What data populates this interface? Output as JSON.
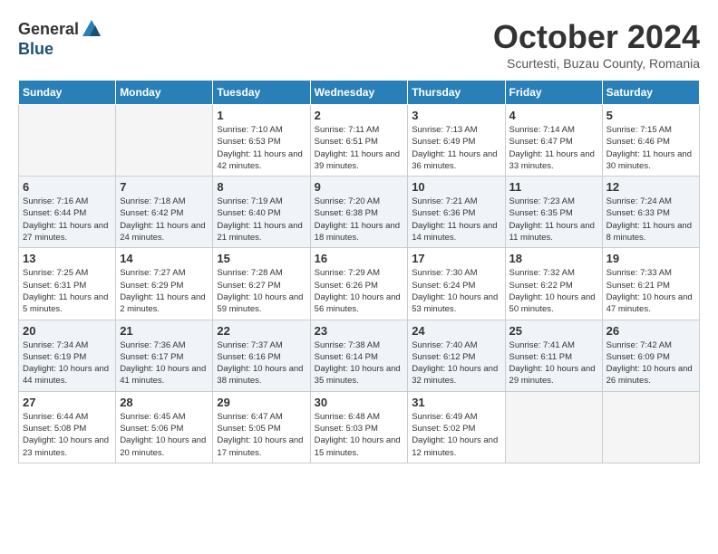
{
  "logo": {
    "general": "General",
    "blue": "Blue"
  },
  "title": "October 2024",
  "location": "Scurtesti, Buzau County, Romania",
  "days_of_week": [
    "Sunday",
    "Monday",
    "Tuesday",
    "Wednesday",
    "Thursday",
    "Friday",
    "Saturday"
  ],
  "weeks": [
    [
      {
        "day": "",
        "sunrise": "",
        "sunset": "",
        "daylight": "",
        "empty": true
      },
      {
        "day": "",
        "sunrise": "",
        "sunset": "",
        "daylight": "",
        "empty": true
      },
      {
        "day": "1",
        "sunrise": "Sunrise: 7:10 AM",
        "sunset": "Sunset: 6:53 PM",
        "daylight": "Daylight: 11 hours and 42 minutes.",
        "empty": false
      },
      {
        "day": "2",
        "sunrise": "Sunrise: 7:11 AM",
        "sunset": "Sunset: 6:51 PM",
        "daylight": "Daylight: 11 hours and 39 minutes.",
        "empty": false
      },
      {
        "day": "3",
        "sunrise": "Sunrise: 7:13 AM",
        "sunset": "Sunset: 6:49 PM",
        "daylight": "Daylight: 11 hours and 36 minutes.",
        "empty": false
      },
      {
        "day": "4",
        "sunrise": "Sunrise: 7:14 AM",
        "sunset": "Sunset: 6:47 PM",
        "daylight": "Daylight: 11 hours and 33 minutes.",
        "empty": false
      },
      {
        "day": "5",
        "sunrise": "Sunrise: 7:15 AM",
        "sunset": "Sunset: 6:46 PM",
        "daylight": "Daylight: 11 hours and 30 minutes.",
        "empty": false
      }
    ],
    [
      {
        "day": "6",
        "sunrise": "Sunrise: 7:16 AM",
        "sunset": "Sunset: 6:44 PM",
        "daylight": "Daylight: 11 hours and 27 minutes.",
        "empty": false
      },
      {
        "day": "7",
        "sunrise": "Sunrise: 7:18 AM",
        "sunset": "Sunset: 6:42 PM",
        "daylight": "Daylight: 11 hours and 24 minutes.",
        "empty": false
      },
      {
        "day": "8",
        "sunrise": "Sunrise: 7:19 AM",
        "sunset": "Sunset: 6:40 PM",
        "daylight": "Daylight: 11 hours and 21 minutes.",
        "empty": false
      },
      {
        "day": "9",
        "sunrise": "Sunrise: 7:20 AM",
        "sunset": "Sunset: 6:38 PM",
        "daylight": "Daylight: 11 hours and 18 minutes.",
        "empty": false
      },
      {
        "day": "10",
        "sunrise": "Sunrise: 7:21 AM",
        "sunset": "Sunset: 6:36 PM",
        "daylight": "Daylight: 11 hours and 14 minutes.",
        "empty": false
      },
      {
        "day": "11",
        "sunrise": "Sunrise: 7:23 AM",
        "sunset": "Sunset: 6:35 PM",
        "daylight": "Daylight: 11 hours and 11 minutes.",
        "empty": false
      },
      {
        "day": "12",
        "sunrise": "Sunrise: 7:24 AM",
        "sunset": "Sunset: 6:33 PM",
        "daylight": "Daylight: 11 hours and 8 minutes.",
        "empty": false
      }
    ],
    [
      {
        "day": "13",
        "sunrise": "Sunrise: 7:25 AM",
        "sunset": "Sunset: 6:31 PM",
        "daylight": "Daylight: 11 hours and 5 minutes.",
        "empty": false
      },
      {
        "day": "14",
        "sunrise": "Sunrise: 7:27 AM",
        "sunset": "Sunset: 6:29 PM",
        "daylight": "Daylight: 11 hours and 2 minutes.",
        "empty": false
      },
      {
        "day": "15",
        "sunrise": "Sunrise: 7:28 AM",
        "sunset": "Sunset: 6:27 PM",
        "daylight": "Daylight: 10 hours and 59 minutes.",
        "empty": false
      },
      {
        "day": "16",
        "sunrise": "Sunrise: 7:29 AM",
        "sunset": "Sunset: 6:26 PM",
        "daylight": "Daylight: 10 hours and 56 minutes.",
        "empty": false
      },
      {
        "day": "17",
        "sunrise": "Sunrise: 7:30 AM",
        "sunset": "Sunset: 6:24 PM",
        "daylight": "Daylight: 10 hours and 53 minutes.",
        "empty": false
      },
      {
        "day": "18",
        "sunrise": "Sunrise: 7:32 AM",
        "sunset": "Sunset: 6:22 PM",
        "daylight": "Daylight: 10 hours and 50 minutes.",
        "empty": false
      },
      {
        "day": "19",
        "sunrise": "Sunrise: 7:33 AM",
        "sunset": "Sunset: 6:21 PM",
        "daylight": "Daylight: 10 hours and 47 minutes.",
        "empty": false
      }
    ],
    [
      {
        "day": "20",
        "sunrise": "Sunrise: 7:34 AM",
        "sunset": "Sunset: 6:19 PM",
        "daylight": "Daylight: 10 hours and 44 minutes.",
        "empty": false
      },
      {
        "day": "21",
        "sunrise": "Sunrise: 7:36 AM",
        "sunset": "Sunset: 6:17 PM",
        "daylight": "Daylight: 10 hours and 41 minutes.",
        "empty": false
      },
      {
        "day": "22",
        "sunrise": "Sunrise: 7:37 AM",
        "sunset": "Sunset: 6:16 PM",
        "daylight": "Daylight: 10 hours and 38 minutes.",
        "empty": false
      },
      {
        "day": "23",
        "sunrise": "Sunrise: 7:38 AM",
        "sunset": "Sunset: 6:14 PM",
        "daylight": "Daylight: 10 hours and 35 minutes.",
        "empty": false
      },
      {
        "day": "24",
        "sunrise": "Sunrise: 7:40 AM",
        "sunset": "Sunset: 6:12 PM",
        "daylight": "Daylight: 10 hours and 32 minutes.",
        "empty": false
      },
      {
        "day": "25",
        "sunrise": "Sunrise: 7:41 AM",
        "sunset": "Sunset: 6:11 PM",
        "daylight": "Daylight: 10 hours and 29 minutes.",
        "empty": false
      },
      {
        "day": "26",
        "sunrise": "Sunrise: 7:42 AM",
        "sunset": "Sunset: 6:09 PM",
        "daylight": "Daylight: 10 hours and 26 minutes.",
        "empty": false
      }
    ],
    [
      {
        "day": "27",
        "sunrise": "Sunrise: 6:44 AM",
        "sunset": "Sunset: 5:08 PM",
        "daylight": "Daylight: 10 hours and 23 minutes.",
        "empty": false
      },
      {
        "day": "28",
        "sunrise": "Sunrise: 6:45 AM",
        "sunset": "Sunset: 5:06 PM",
        "daylight": "Daylight: 10 hours and 20 minutes.",
        "empty": false
      },
      {
        "day": "29",
        "sunrise": "Sunrise: 6:47 AM",
        "sunset": "Sunset: 5:05 PM",
        "daylight": "Daylight: 10 hours and 17 minutes.",
        "empty": false
      },
      {
        "day": "30",
        "sunrise": "Sunrise: 6:48 AM",
        "sunset": "Sunset: 5:03 PM",
        "daylight": "Daylight: 10 hours and 15 minutes.",
        "empty": false
      },
      {
        "day": "31",
        "sunrise": "Sunrise: 6:49 AM",
        "sunset": "Sunset: 5:02 PM",
        "daylight": "Daylight: 10 hours and 12 minutes.",
        "empty": false
      },
      {
        "day": "",
        "sunrise": "",
        "sunset": "",
        "daylight": "",
        "empty": true
      },
      {
        "day": "",
        "sunrise": "",
        "sunset": "",
        "daylight": "",
        "empty": true
      }
    ]
  ]
}
